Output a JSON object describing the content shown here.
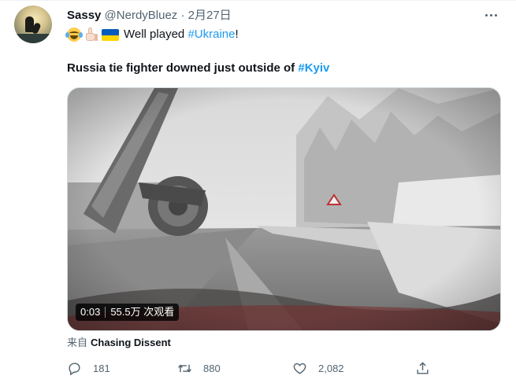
{
  "tweet": {
    "display_name": "Sassy",
    "handle": "@NerdyBluez",
    "separator": "·",
    "date": "2月27日",
    "line1_text": "Well played ",
    "line1_hashtag": "#Ukraine",
    "line1_suffix": "!",
    "line2_text": "Russia tie fighter downed just outside of ",
    "line2_hashtag": "#Kyiv",
    "emojis": [
      "face-with-tears-of-joy",
      "thumbs-up-light-skin",
      "ukraine-flag"
    ]
  },
  "video": {
    "duration": "0:03",
    "views": "55.5万 次观看"
  },
  "source": {
    "prefix": "来自",
    "account": "Chasing Dissent"
  },
  "actions": {
    "reply_count": "181",
    "retweet_count": "880",
    "like_count": "2,082"
  },
  "colors": {
    "link": "#1d9bf0",
    "secondary_text": "#536471",
    "primary_text": "#0f1419"
  }
}
